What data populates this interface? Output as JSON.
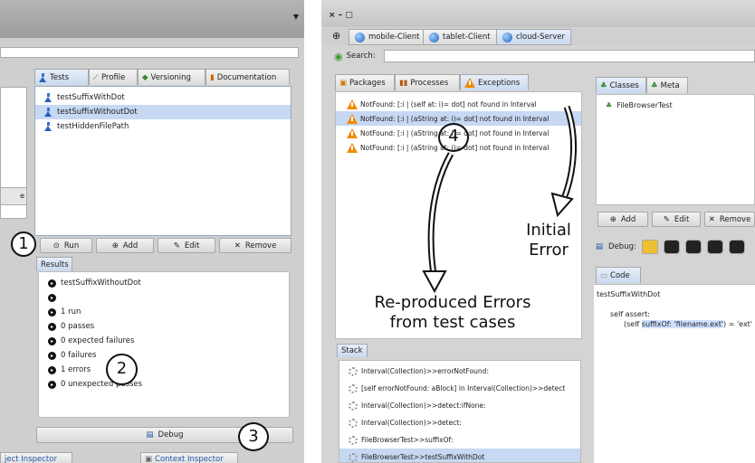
{
  "left": {
    "tabs": [
      {
        "label": "Tests",
        "icon": "flask-icon"
      },
      {
        "label": "Profile",
        "icon": "chart-icon"
      },
      {
        "label": "Versioning",
        "icon": "git-icon"
      },
      {
        "label": "Documentation",
        "icon": "book-icon"
      }
    ],
    "tests": [
      "testSuffixWithDot",
      "testSuffixWithoutDot",
      "testHiddenFilePath"
    ],
    "buttons": {
      "run": "Run",
      "add": "Add",
      "edit": "Edit",
      "remove": "Remove"
    },
    "results_tab": "Results",
    "results": [
      "testSuffixWithoutDot",
      "",
      "1 run",
      "0 passes",
      "0 expected failures",
      "0 failures",
      "1 errors",
      "0 unexpected passes"
    ],
    "debug_label": "Debug",
    "bottom_tabs": [
      "ject Inspector",
      "Context Inspector"
    ]
  },
  "right": {
    "window_controls": "× – □",
    "client_tabs": [
      "mobile-Client",
      "tablet-Client",
      "cloud-Server"
    ],
    "search_label": "Search:",
    "main_tabs": [
      "Packages",
      "Processes",
      "Exceptions"
    ],
    "exceptions": [
      "NotFound: [:i | (self at: i)= dot] not found in Interval",
      "NotFound: [:i | (aString at: i)= dot] not found in Interval",
      "NotFound: [:i | (aString at: i)= dot] not found in Interval",
      "NotFound: [:i | (aString at: i)= dot] not found in Interval"
    ],
    "class_tabs": [
      "Classes",
      "Meta"
    ],
    "classes": [
      "FileBrowserTest"
    ],
    "buttons": {
      "add": "Add",
      "edit": "Edit",
      "remove": "Remove"
    },
    "debug_label": "Debug:",
    "code_tab": "Code",
    "code": {
      "method": "testSuffixWithDot",
      "line1": "self assert:",
      "line2_pre": "(self ",
      "line2_hl": "suffixOf: 'filename.ext'",
      "line2_post": ") = 'ext'"
    },
    "stack_tab": "Stack",
    "stack": [
      "Interval(Collection)>>errorNotFound:",
      "[self errorNotFound: aBlock] in Interval(Collection)>>detect",
      "Interval(Collection)>>detect:ifNone:",
      "Interval(Collection)>>detect:",
      "FileBrowserTest>>suffixOf:",
      "FileBrowserTest>>testSuffixWithDot"
    ]
  },
  "annotations": {
    "n1": "1",
    "n2": "2",
    "n3": "3",
    "n4": "4",
    "initial_error_1": "Initial",
    "initial_error_2": "Error",
    "reproduced_1": "Re-produced Errors",
    "reproduced_2": "from test cases"
  }
}
